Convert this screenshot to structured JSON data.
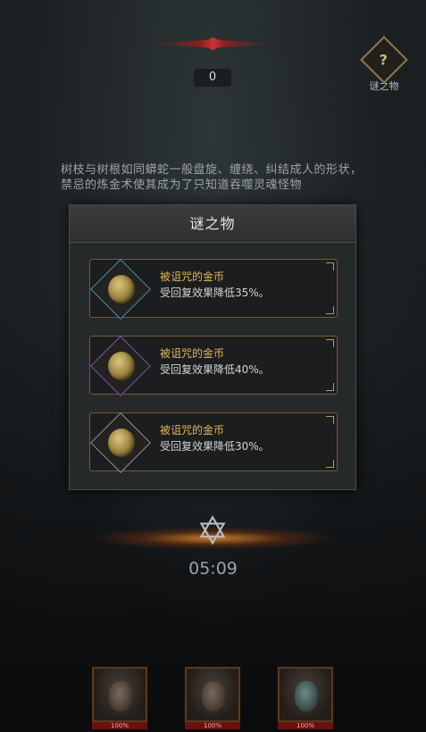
{
  "hud": {
    "score": "0",
    "mystery_label": "谜之物",
    "mystery_emblem": "?"
  },
  "story_text": "树枝与树根如同蟒蛇一般盘旋、缠绕、纠结成人的形状，禁忌的炼金术使其成为了只知道吞噬灵魂怪物",
  "modal": {
    "title": "谜之物",
    "items": [
      {
        "name": "被诅咒的金币",
        "desc": "受回复效果降低35%。",
        "frame_color": "#3f8fb0"
      },
      {
        "name": "被诅咒的金币",
        "desc": "受回复效果降低40%。",
        "frame_color": "#7a52b8"
      },
      {
        "name": "被诅咒的金币",
        "desc": "受回复效果降低30%。",
        "frame_color": "#8f8f8f"
      }
    ]
  },
  "timer": "05:09",
  "heroes": [
    {
      "hp": "100%"
    },
    {
      "hp": "100%"
    },
    {
      "hp": "100%"
    }
  ],
  "colors": {
    "item_name": "#e2b75a",
    "hp_bar": "#6b1010"
  }
}
